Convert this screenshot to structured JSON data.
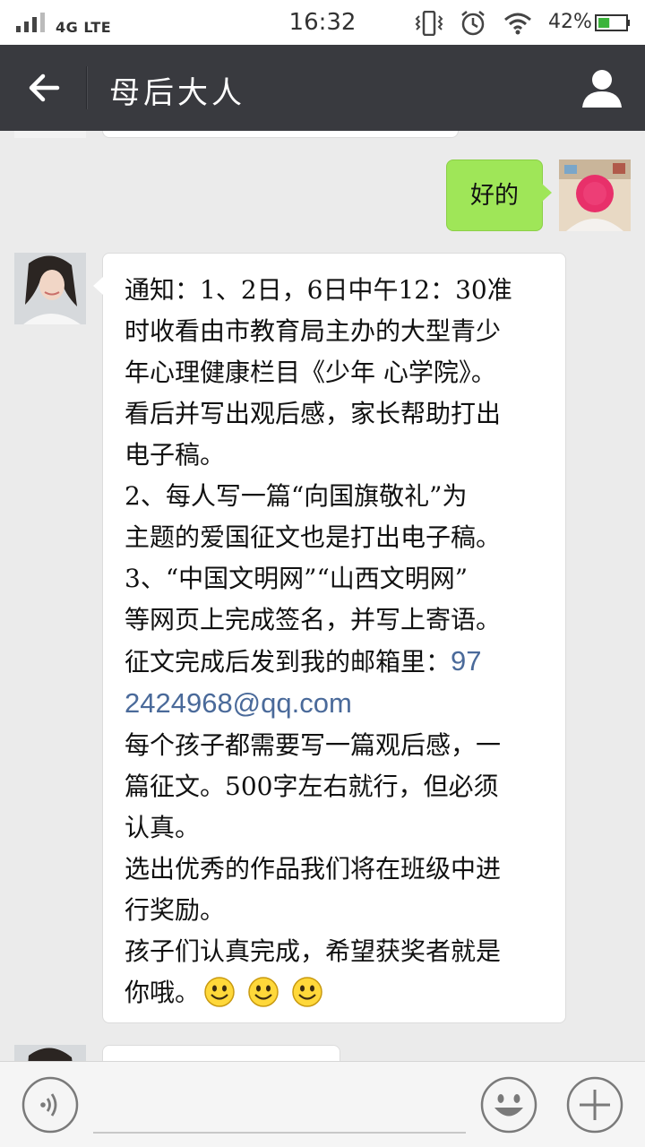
{
  "status_bar": {
    "network": "4G LTE",
    "time": "16:32",
    "battery_percent": "42%",
    "battery_level": 0.42,
    "icons": [
      "signal-icon",
      "vibrate-icon",
      "alarm-icon",
      "wifi-icon",
      "battery-icon"
    ]
  },
  "header": {
    "title": "母后大人",
    "back_icon": "back-arrow-icon",
    "contact_icon": "person-icon",
    "background": "#393a3f"
  },
  "messages": [
    {
      "direction": "out",
      "text": "好的",
      "bubble_color": "#9fe658"
    },
    {
      "direction": "in",
      "lines": [
        "通知：1、2日，6日中午12：30准",
        "时收看由市教育局主办的大型青少",
        "年心理健康栏目《少年 心学院》。",
        "看后并写出观后感，家长帮助打出",
        "电子稿。",
        "2、每人写一篇“向国旗敬礼”为",
        "主题的爱国征文也是打出电子稿。",
        "3、“中国文明网”“山西文明网”",
        "等网页上完成签名，并写上寄语。"
      ],
      "email_prefix": "征文完成后发到我的邮箱里：",
      "email_part1": "97",
      "email_part2": "2424968@qq.com",
      "lines_after": [
        "每个孩子都需要写一篇观后感，一",
        "篇征文。500字左右就行，但必须",
        "认真。",
        "选出优秀的作品我们将在班级中进",
        "行奖励。",
        "孩子们认真完成，希望获奖者就是"
      ],
      "last_line": "你哦。",
      "emojis": [
        "smile-emoji",
        "smile-emoji",
        "smile-emoji"
      ]
    }
  ],
  "input_bar": {
    "voice_icon": "voice-icon",
    "emoji_icon": "emoji-face-icon",
    "plus_icon": "plus-icon",
    "input_value": ""
  }
}
